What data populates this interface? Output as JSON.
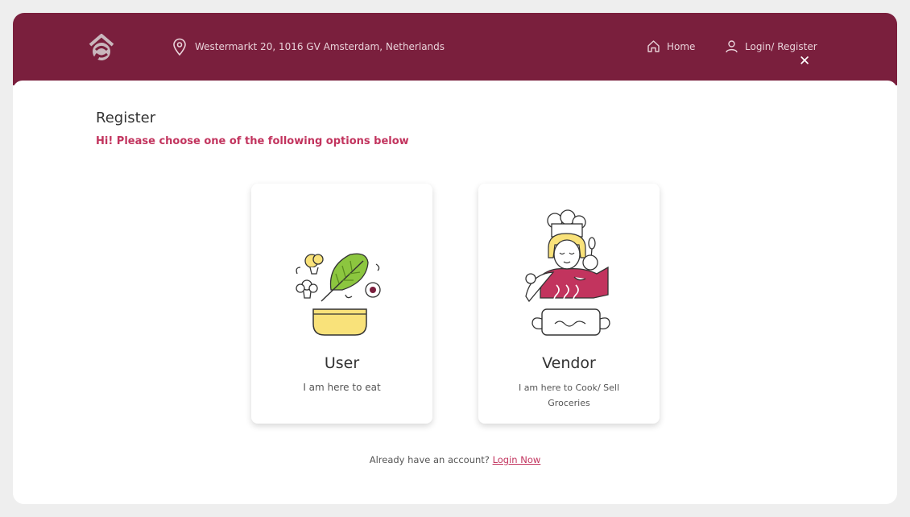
{
  "header": {
    "location": "Westermarkt 20, 1016 GV Amsterdam, Netherlands",
    "nav": {
      "home": "Home",
      "login": "Login/ Register"
    },
    "close": "✕"
  },
  "main": {
    "title": "Register",
    "subtitle": "Hi! Please choose one of the following options below",
    "options": [
      {
        "title": "User",
        "description": "I am here to eat"
      },
      {
        "title": "Vendor",
        "description": "I am here to Cook/ Sell Groceries"
      }
    ],
    "footer": {
      "text": "Already have an account?",
      "link": "Login Now"
    }
  },
  "colors": {
    "brand": "#7a1f3d",
    "accent": "#c2345e",
    "yellow": "#f9e27a",
    "green": "#8cc63f"
  },
  "icons": [
    "logo-icon",
    "location-pin-icon",
    "home-icon",
    "user-icon",
    "close-icon",
    "food-bowl-illustration",
    "chef-illustration"
  ]
}
